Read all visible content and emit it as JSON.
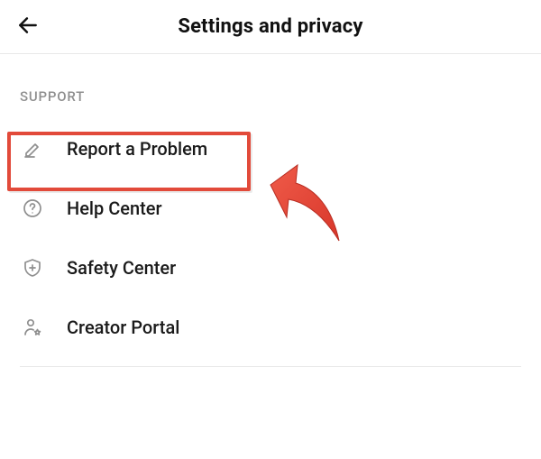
{
  "header": {
    "title": "Settings and privacy"
  },
  "section": {
    "heading": "SUPPORT",
    "items": [
      {
        "label": "Report a Problem"
      },
      {
        "label": "Help Center"
      },
      {
        "label": "Safety Center"
      },
      {
        "label": "Creator Portal"
      }
    ]
  },
  "annotation": {
    "highlight_color": "#e24a3a"
  }
}
